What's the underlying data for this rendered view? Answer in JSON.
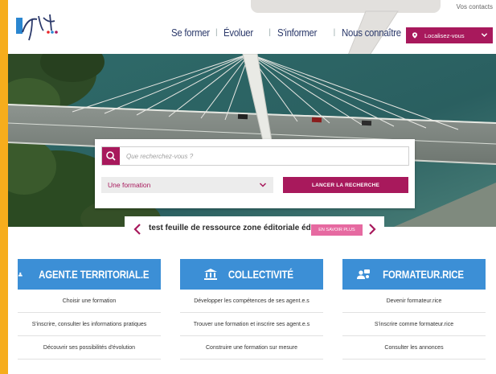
{
  "header": {
    "top_link": "Vos contacts",
    "nav": [
      "Se former",
      "Évoluer",
      "S'informer",
      "Nous connaître"
    ],
    "localise_label": "Localisez-vous"
  },
  "search": {
    "placeholder": "Que recherchez-vous ?",
    "select_value": "Une formation",
    "launch_label": "LANCER LA RECHERCHE"
  },
  "editorial": {
    "text": "test feuille de ressource zone éditoriale éd",
    "more_label": "EN SAVOIR PLUS"
  },
  "columns": [
    {
      "title": "AGENT.E TERRITORIAL.E",
      "icon": "user-icon",
      "links": [
        "Choisir une formation",
        "S'inscrire, consulter les informations pratiques",
        "Découvrir ses possibilités d'évolution"
      ]
    },
    {
      "title": "COLLECTIVITÉ",
      "icon": "building-icon",
      "links": [
        "Développer les compétences de ses agent.e.s",
        "Trouver une formation et inscrire ses agent.e.s",
        "Construire une formation sur mesure"
      ]
    },
    {
      "title": "FORMATEUR.RICE",
      "icon": "people-icon",
      "links": [
        "Devenir formateur.rice",
        "S'inscrire comme formateur.rice",
        "Consulter les annonces"
      ]
    }
  ],
  "colors": {
    "brand": "#a8195c",
    "blue": "#3c8fd6",
    "frame": "#f6ad1c"
  }
}
